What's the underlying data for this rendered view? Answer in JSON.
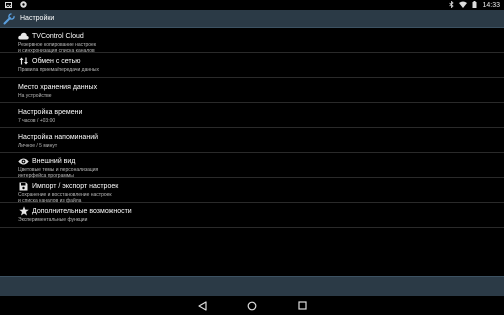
{
  "status": {
    "time": "14:33"
  },
  "appbar": {
    "title": "Настройки"
  },
  "items": [
    {
      "title": "TVControl Cloud",
      "subtitle": "Резервное копирование настроек",
      "subtitle2": "и синхронизация списка каналов",
      "icon": "cloud-icon"
    },
    {
      "title": "Обмен с сетью",
      "subtitle": "Правила приема/передачи данных",
      "subtitle2": "",
      "icon": "transfer-arrows-icon"
    },
    {
      "title": "Место хранения данных",
      "subtitle": "На устройстве",
      "subtitle2": "",
      "icon": ""
    },
    {
      "title": "Настройка времени",
      "subtitle": "7 часов / +03:00",
      "subtitle2": "",
      "icon": ""
    },
    {
      "title": "Настройка напоминаний",
      "subtitle": "Личное / 5 минут",
      "subtitle2": "",
      "icon": ""
    },
    {
      "title": "Внешний вид",
      "subtitle": "Цветовые темы и персонализация",
      "subtitle2": "интерфейса программы",
      "icon": "eye-icon"
    },
    {
      "title": "Импорт / экспорт настроек",
      "subtitle": "Сохранение и восстановление настроек",
      "subtitle2": "и списка каналов из файла",
      "icon": "save-icon"
    },
    {
      "title": "Дополнительные возможности",
      "subtitle": "Экспериментальные функции",
      "subtitle2": "",
      "icon": "star-icon"
    }
  ],
  "colors": {
    "appbar": "#2b3a46",
    "background": "#000000"
  }
}
